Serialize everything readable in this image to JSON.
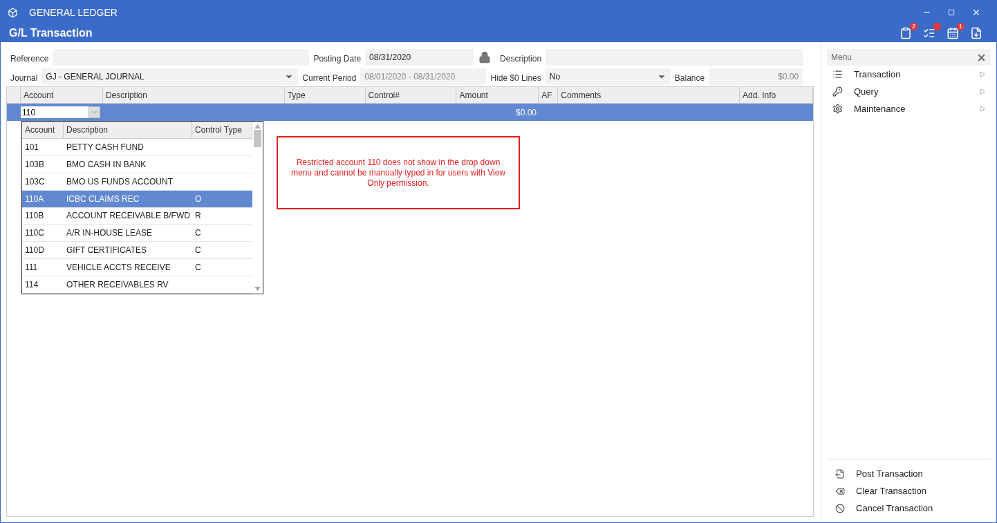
{
  "window": {
    "title": "GENERAL LEDGER",
    "subtitle": "G/L Transaction"
  },
  "toolbar": [
    {
      "kind": "clipboard",
      "badge": "2",
      "dot": false
    },
    {
      "kind": "list",
      "dot": true
    },
    {
      "kind": "calendar",
      "badge": "1",
      "dot": false
    },
    {
      "kind": "export",
      "dot": false
    }
  ],
  "form": {
    "reference": {
      "label": "Reference"
    },
    "posting_date": {
      "label": "Posting Date",
      "value": "08/31/2020",
      "locked": true
    },
    "description": {
      "label": "Description"
    },
    "journal": {
      "label": "Journal",
      "value": "GJ - GENERAL JOURNAL"
    },
    "current_period": {
      "label": "Current Period",
      "value": "08/01/2020 - 08/31/2020",
      "disabled": true
    },
    "hide_zero_lines": {
      "label": "Hide $0 Lines",
      "value": "No"
    },
    "balance": {
      "label": "Balance",
      "value": "$0.00",
      "disabled": true
    }
  },
  "grid": {
    "columns": [
      "Account",
      "Description",
      "Type",
      "Control#",
      "Amount",
      "AF",
      "Comments",
      "Add. Info"
    ],
    "rows": [
      {
        "account": "110",
        "amount": "$0.00",
        "selected": true
      }
    ]
  },
  "account_dropdown": {
    "columns": [
      "Account",
      "Description",
      "Control Type"
    ],
    "rows": [
      {
        "account": "101",
        "description": "PETTY CASH FUND",
        "control_type": "",
        "selected": false
      },
      {
        "account": "103B",
        "description": "BMO CASH IN BANK",
        "control_type": "",
        "selected": false
      },
      {
        "account": "103C",
        "description": "BMO US FUNDS ACCOUNT",
        "control_type": "",
        "selected": false
      },
      {
        "account": "110A",
        "description": "ICBC CLAIMS REC",
        "control_type": "O",
        "selected": true
      },
      {
        "account": "110B",
        "description": "ACCOUNT RECEIVABLE B/FWD",
        "control_type": "R",
        "selected": false
      },
      {
        "account": "110C",
        "description": "A/R IN-HOUSE LEASE",
        "control_type": "C",
        "selected": false
      },
      {
        "account": "110D",
        "description": "GIFT CERTIFICATES",
        "control_type": "C",
        "selected": false
      },
      {
        "account": "111",
        "description": "VEHICLE ACCTS RECEIVE",
        "control_type": "C",
        "selected": false
      },
      {
        "account": "114",
        "description": "OTHER RECEIVABLES RV",
        "control_type": "",
        "selected": false
      }
    ]
  },
  "annotation": "Restricted account 110 does not show in the drop down menu and cannot be manually typed in for users with View Only permission.",
  "menu": {
    "title": "Menu",
    "items": [
      {
        "kind": "list",
        "label": "Transaction"
      },
      {
        "kind": "query",
        "label": "Query"
      },
      {
        "kind": "gear",
        "label": "Maintenance"
      }
    ],
    "actions": [
      {
        "kind": "post",
        "label": "Post Transaction"
      },
      {
        "kind": "clear",
        "label": "Clear Transaction"
      },
      {
        "kind": "cancel",
        "label": "Cancel Transaction"
      }
    ]
  }
}
